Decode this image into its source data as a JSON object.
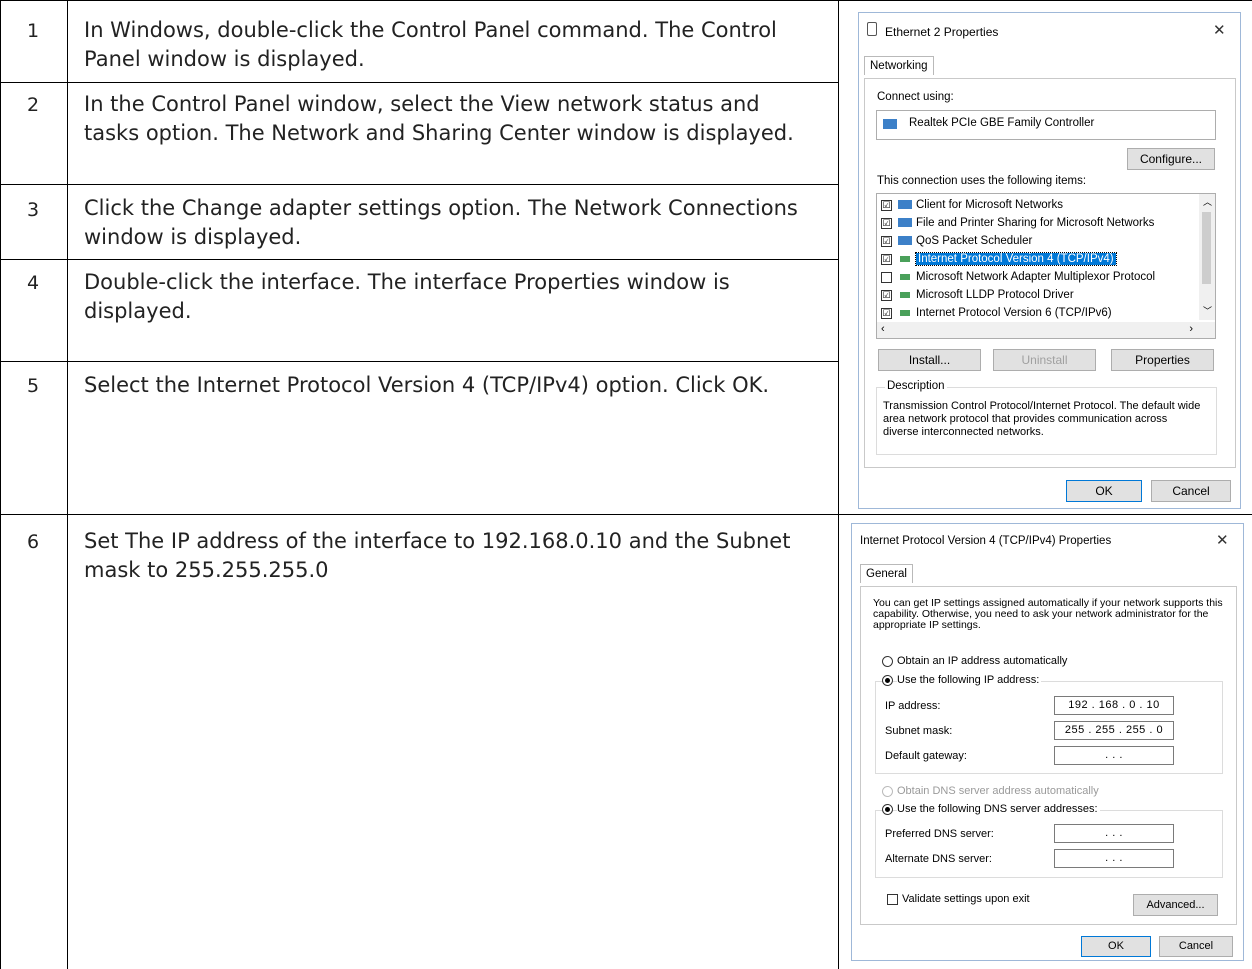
{
  "steps": [
    {
      "num": "1",
      "text": "In Windows, double-click the Control Panel command. The Control Panel window is displayed."
    },
    {
      "num": "2",
      "text": "In the Control Panel window, select the View network status and tasks option. The Network and Sharing Center window is displayed."
    },
    {
      "num": "3",
      "text": "Click the Change adapter settings option. The Network Connections window is displayed."
    },
    {
      "num": "4",
      "text": "Double-click the interface. The interface Properties window is displayed."
    },
    {
      "num": "5",
      "text": "Select the Internet Protocol Version 4 (TCP/IPv4) option. Click OK."
    },
    {
      "num": "6",
      "text": "Set The IP address of the interface to 192.168.0.10 and the Subnet mask to 255.255.255.0"
    }
  ],
  "eth": {
    "title": "Ethernet 2 Properties",
    "close": "✕",
    "tab": "Networking",
    "connect_using": "Connect using:",
    "adapter": "Realtek PCIe GBE Family Controller",
    "configure": "Configure...",
    "items_label": "This connection uses the following items:",
    "items": [
      {
        "label": "Client for Microsoft Networks",
        "checked": "☑"
      },
      {
        "label": "File and Printer Sharing for Microsoft Networks",
        "checked": "☑"
      },
      {
        "label": "QoS Packet Scheduler",
        "checked": "☑"
      },
      {
        "label": "Internet Protocol Version 4 (TCP/IPv4)",
        "checked": "☑"
      },
      {
        "label": "Microsoft Network Adapter Multiplexor Protocol",
        "checked": ""
      },
      {
        "label": "Microsoft LLDP Protocol Driver",
        "checked": "☑"
      },
      {
        "label": "Internet Protocol Version 6 (TCP/IPv6)",
        "checked": "☑"
      }
    ],
    "install": "Install...",
    "uninstall": "Uninstall",
    "properties": "Properties",
    "description_label": "Description",
    "description": "Transmission Control Protocol/Internet Protocol. The default wide area network protocol that provides communication across diverse interconnected networks.",
    "ok": "OK",
    "cancel": "Cancel"
  },
  "ipv4": {
    "title": "Internet Protocol Version 4 (TCP/IPv4) Properties",
    "close": "✕",
    "tab": "General",
    "intro": "You can get IP settings assigned automatically if your network supports this capability. Otherwise, you need to ask your network administrator for the appropriate IP settings.",
    "auto_ip": "Obtain an IP address automatically",
    "use_ip": "Use the following IP address:",
    "ip_label": "IP address:",
    "ip_value": "192 . 168 .  0  .  10",
    "mask_label": "Subnet mask:",
    "mask_value": "255 . 255 . 255 .  0",
    "gw_label": "Default gateway:",
    "gw_value": ".       .       .",
    "auto_dns": "Obtain DNS server address automatically",
    "use_dns": "Use the following DNS server addresses:",
    "pref_dns_label": "Preferred DNS server:",
    "pref_dns_value": ".       .       .",
    "alt_dns_label": "Alternate DNS server:",
    "alt_dns_value": ".       .       .",
    "validate": "Validate settings upon exit",
    "advanced": "Advanced...",
    "ok": "OK",
    "cancel": "Cancel"
  }
}
